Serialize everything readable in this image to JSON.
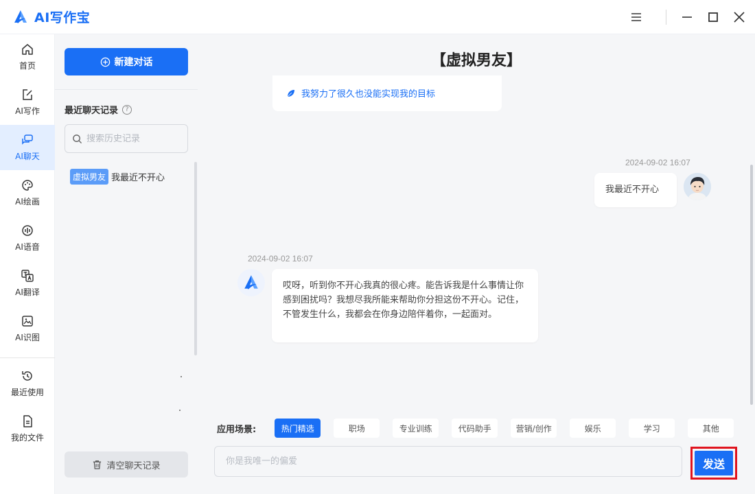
{
  "app": {
    "title": "AI写作宝"
  },
  "window_controls": [
    "menu-icon",
    "minimize-icon",
    "maximize-icon",
    "close-icon"
  ],
  "nav": {
    "items": [
      {
        "label": "首页",
        "icon": "home-icon",
        "active": false
      },
      {
        "label": "AI写作",
        "icon": "edit-icon",
        "active": false
      },
      {
        "label": "AI聊天",
        "icon": "chat-icon",
        "active": true
      },
      {
        "label": "AI绘画",
        "icon": "palette-icon",
        "active": false
      },
      {
        "label": "AI语音",
        "icon": "voice-icon",
        "active": false
      },
      {
        "label": "AI翻译",
        "icon": "translate-icon",
        "active": false
      },
      {
        "label": "AI识图",
        "icon": "image-icon",
        "active": false
      },
      {
        "label": "最近使用",
        "icon": "history-icon",
        "active": false
      },
      {
        "label": "我的文件",
        "icon": "file-icon",
        "active": false
      }
    ]
  },
  "history": {
    "new_chat_label": "新建对话",
    "recent_title": "最近聊天记录",
    "help_glyph": "?",
    "search_placeholder": "搜索历史记录",
    "items": [
      {
        "tag": "虚拟男友",
        "text": "我最近不开心"
      }
    ],
    "clear_label": "清空聊天记录"
  },
  "chat": {
    "title": "【虚拟男友】",
    "tip_text": "我努力了很久也没能实现我的目标",
    "messages": [
      {
        "role": "user",
        "time": "2024-09-02 16:07",
        "text": "我最近不开心"
      },
      {
        "role": "assistant",
        "time": "2024-09-02 16:07",
        "text": "哎呀，听到你不开心我真的很心疼。能告诉我是什么事情让你感到困扰吗？我想尽我所能来帮助你分担这份不开心。记住，不管发生什么，我都会在你身边陪伴着你，一起面对。"
      }
    ]
  },
  "scenes": {
    "label": "应用场景:",
    "tags": [
      "热门精选",
      "职场",
      "专业训练",
      "代码助手",
      "营销/创作",
      "娱乐",
      "学习",
      "其他"
    ],
    "active_index": 0
  },
  "composer": {
    "placeholder": "你是我唯一的偏爱",
    "send_label": "发送"
  },
  "colors": {
    "accent": "#1a6ff5",
    "highlight_border": "#e0141e",
    "panel_bg": "#f5f6f8"
  }
}
